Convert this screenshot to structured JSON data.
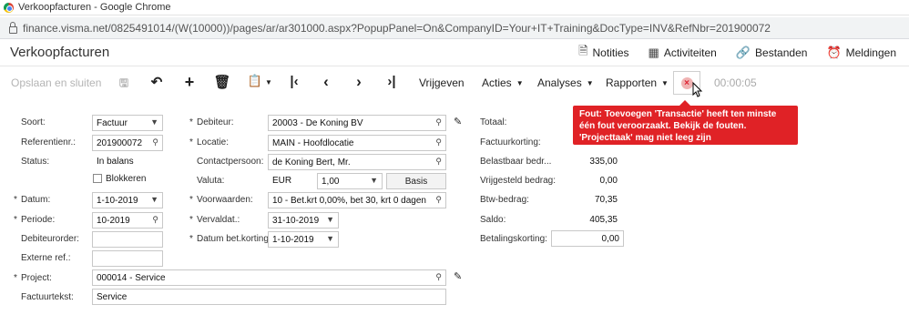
{
  "browser": {
    "window_title": "Verkoopfacturen - Google Chrome",
    "url": "finance.visma.net/0825491014/(W(10000))/pages/ar/ar301000.aspx?PopupPanel=On&CompanyID=Your+IT+Training&DocType=INV&RefNbr=201900072"
  },
  "header": {
    "title": "Verkoopfacturen",
    "actions": [
      "Notities",
      "Activiteiten",
      "Bestanden",
      "Meldingen"
    ]
  },
  "toolbar": {
    "save_close": "Opslaan en sluiten",
    "release": "Vrijgeven",
    "menus": [
      "Acties",
      "Analyses",
      "Rapporten"
    ],
    "timer": "00:00:05"
  },
  "error_tooltip": "Fout: Toevoegen 'Transactie' heeft ten minste één fout veroorzaakt. Bekijk de fouten. 'Projecttaak' mag niet leeg zijn",
  "form": {
    "soort": {
      "label": "Soort:",
      "value": "Factuur"
    },
    "referentienr": {
      "label": "Referentienr.:",
      "value": "201900072"
    },
    "status": {
      "label": "Status:",
      "value": "In balans"
    },
    "blokkeren": {
      "label": "Blokkeren",
      "checked": false
    },
    "datum": {
      "label": "Datum:",
      "value": "1-10-2019"
    },
    "periode": {
      "label": "Periode:",
      "value": "10-2019"
    },
    "debiteurorder": {
      "label": "Debiteurorder:",
      "value": ""
    },
    "externe_ref": {
      "label": "Externe ref.:",
      "value": ""
    },
    "project": {
      "label": "Project:",
      "value": "000014 - Service"
    },
    "factuurtekst": {
      "label": "Factuurtekst:",
      "value": "Service"
    },
    "debiteur": {
      "label": "Debiteur:",
      "value": "20003 - De Koning BV"
    },
    "locatie": {
      "label": "Locatie:",
      "value": "MAIN - Hoofdlocatie"
    },
    "contactpersoon": {
      "label": "Contactpersoon:",
      "value": "de Koning Bert, Mr."
    },
    "valuta": {
      "label": "Valuta:",
      "value": "EUR",
      "rate": "1,00",
      "basis": "Basis"
    },
    "voorwaarden": {
      "label": "Voorwaarden:",
      "value": "10 - Bet.krt 0,00%, bet 30, krt 0 dagen"
    },
    "vervaldat": {
      "label": "Vervaldat.:",
      "value": "31-10-2019"
    },
    "datum_bet_korting": {
      "label": "Datum bet.korting:",
      "value": "1-10-2019"
    }
  },
  "totals": {
    "totaal": {
      "label": "Totaal:",
      "value": ""
    },
    "factuurkorting": {
      "label": "Factuurkorting:",
      "value": ""
    },
    "belastbaar": {
      "label": "Belastbaar bedr...",
      "value": "335,00"
    },
    "vrijgesteld": {
      "label": "Vrijgesteld bedrag:",
      "value": "0,00"
    },
    "btw": {
      "label": "Btw-bedrag:",
      "value": "70,35"
    },
    "saldo": {
      "label": "Saldo:",
      "value": "405,35"
    },
    "betalingskorting": {
      "label": "Betalingskorting:",
      "value": "0,00"
    }
  }
}
